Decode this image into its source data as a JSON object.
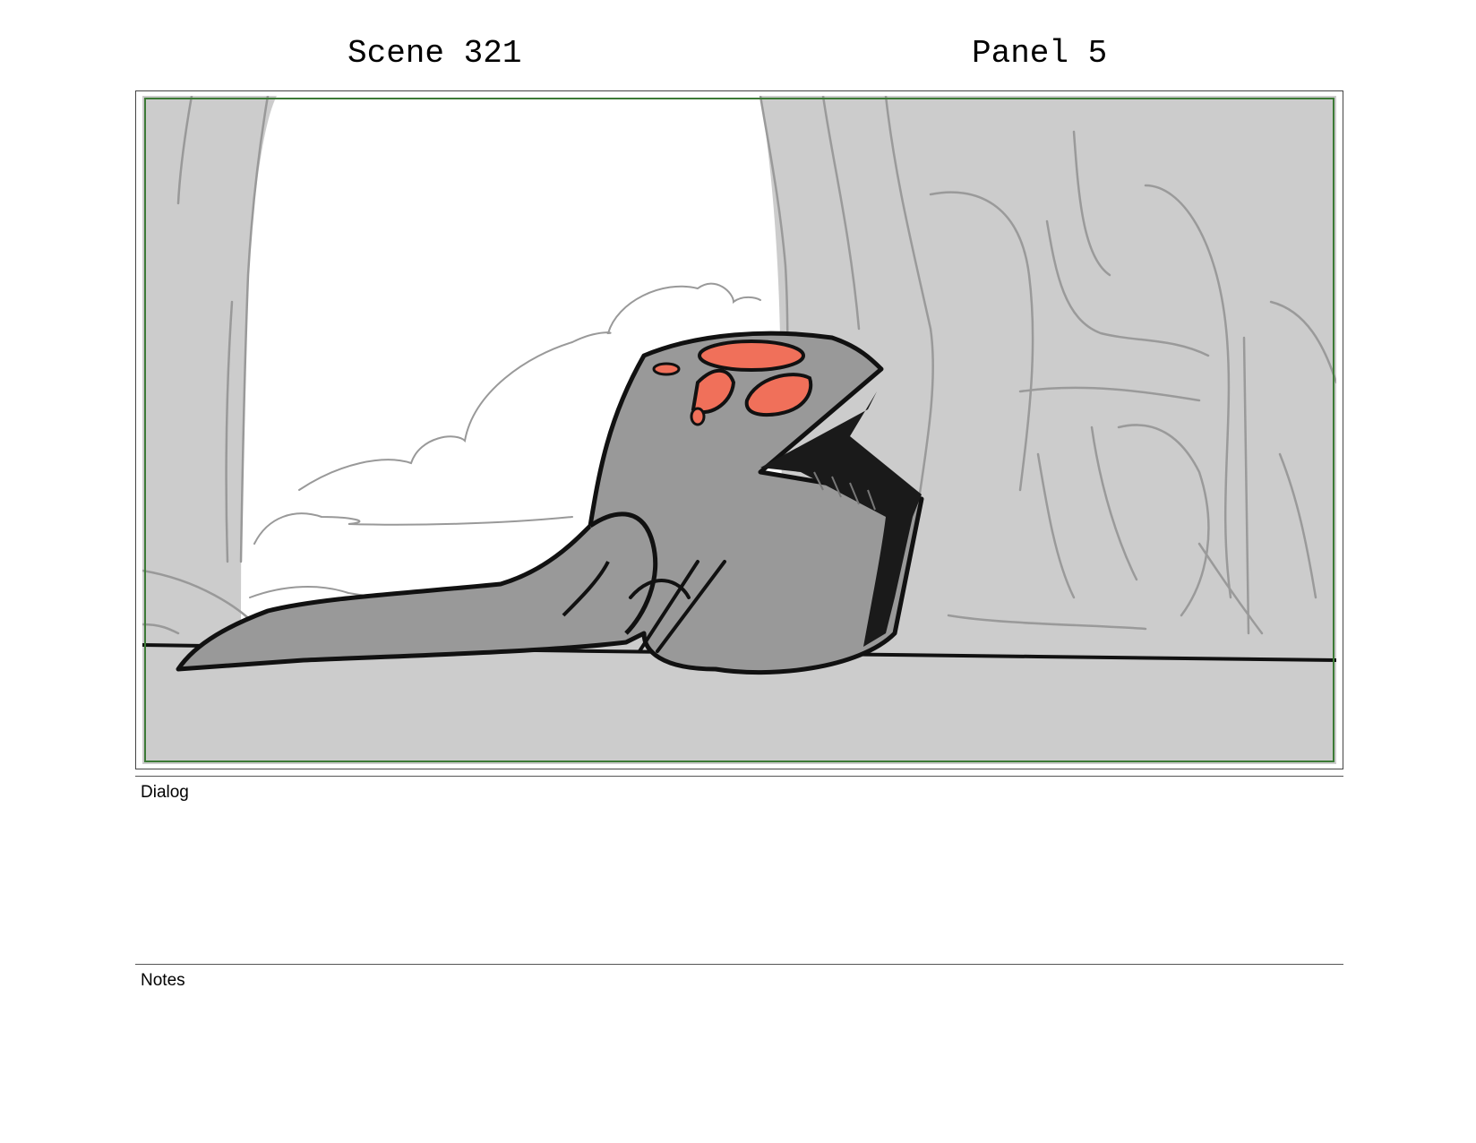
{
  "header": {
    "scene": "Scene 321",
    "panel": "Panel 5"
  },
  "panel_image": {
    "description_icon": "storyboard-sketch-image",
    "colors": {
      "background": "#cccccc",
      "sky": "#ffffff",
      "creature_body": "#999999",
      "creature_eyes": "#f0705a",
      "safe_area": "#3c7a36"
    }
  },
  "dialog": {
    "label": "Dialog",
    "text": ""
  },
  "notes": {
    "label": "Notes",
    "text": ""
  }
}
